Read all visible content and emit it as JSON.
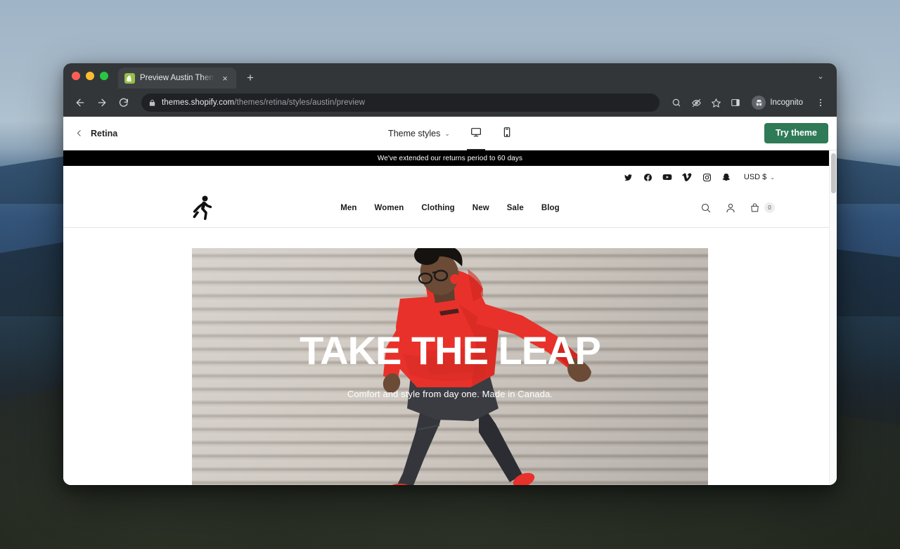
{
  "browser": {
    "tab": {
      "title": "Preview Austin Theme - Retina",
      "favicon": "shopify-bag-icon",
      "close": "×"
    },
    "new_tab_label": "+",
    "tabstrip_chevron": "⌄",
    "nav": {
      "back": "back-arrow-icon",
      "forward": "forward-arrow-icon",
      "reload": "reload-icon"
    },
    "omnibox": {
      "lock": "lock-icon",
      "url_domain": "themes.shopify.com",
      "url_path": "/themes/retina/styles/austin/preview"
    },
    "toolbar_icons": [
      {
        "name": "search-icon",
        "glyph": "search"
      },
      {
        "name": "tracking-protection-icon",
        "glyph": "eye-slash"
      },
      {
        "name": "bookmark-star-icon",
        "glyph": "star"
      },
      {
        "name": "side-panel-icon",
        "glyph": "panel"
      }
    ],
    "incognito": {
      "label": "Incognito",
      "avatar": "incognito-hat-glasses-icon"
    },
    "menu_icon": "three-dot-menu-icon"
  },
  "theme_bar": {
    "back_chevron": "chevron-left-icon",
    "theme_name": "Retina",
    "theme_styles_label": "Theme styles",
    "theme_styles_caret": "⌄",
    "devices": [
      {
        "name": "desktop-view-button",
        "icon": "desktop-monitor-icon",
        "active": true
      },
      {
        "name": "mobile-view-button",
        "icon": "mobile-phone-icon",
        "active": false
      }
    ],
    "try_theme_label": "Try theme",
    "try_theme_color": "#2f7a57"
  },
  "store": {
    "announcement": "We've extended our returns period to 60 days",
    "announcement_bg": "#000000",
    "social": [
      {
        "name": "twitter-icon"
      },
      {
        "name": "facebook-icon"
      },
      {
        "name": "youtube-icon"
      },
      {
        "name": "vimeo-icon"
      },
      {
        "name": "instagram-icon"
      },
      {
        "name": "snapchat-icon"
      }
    ],
    "currency": {
      "label": "USD $",
      "caret": "⌄"
    },
    "logo_name": "running-person-logo",
    "nav": [
      {
        "label": "Men"
      },
      {
        "label": "Women"
      },
      {
        "label": "Clothing"
      },
      {
        "label": "New"
      },
      {
        "label": "Sale"
      },
      {
        "label": "Blog"
      }
    ],
    "actions": {
      "search": "search-icon",
      "account": "account-person-icon",
      "cart": "shopping-bag-icon",
      "cart_count": "0"
    },
    "hero": {
      "title": "TAKE THE LEAP",
      "subtitle": "Comfort and style from day one. Made in Canada.",
      "image_alt": "man-in-red-hoodie-jumping",
      "accent_color": "#e8312a"
    }
  }
}
